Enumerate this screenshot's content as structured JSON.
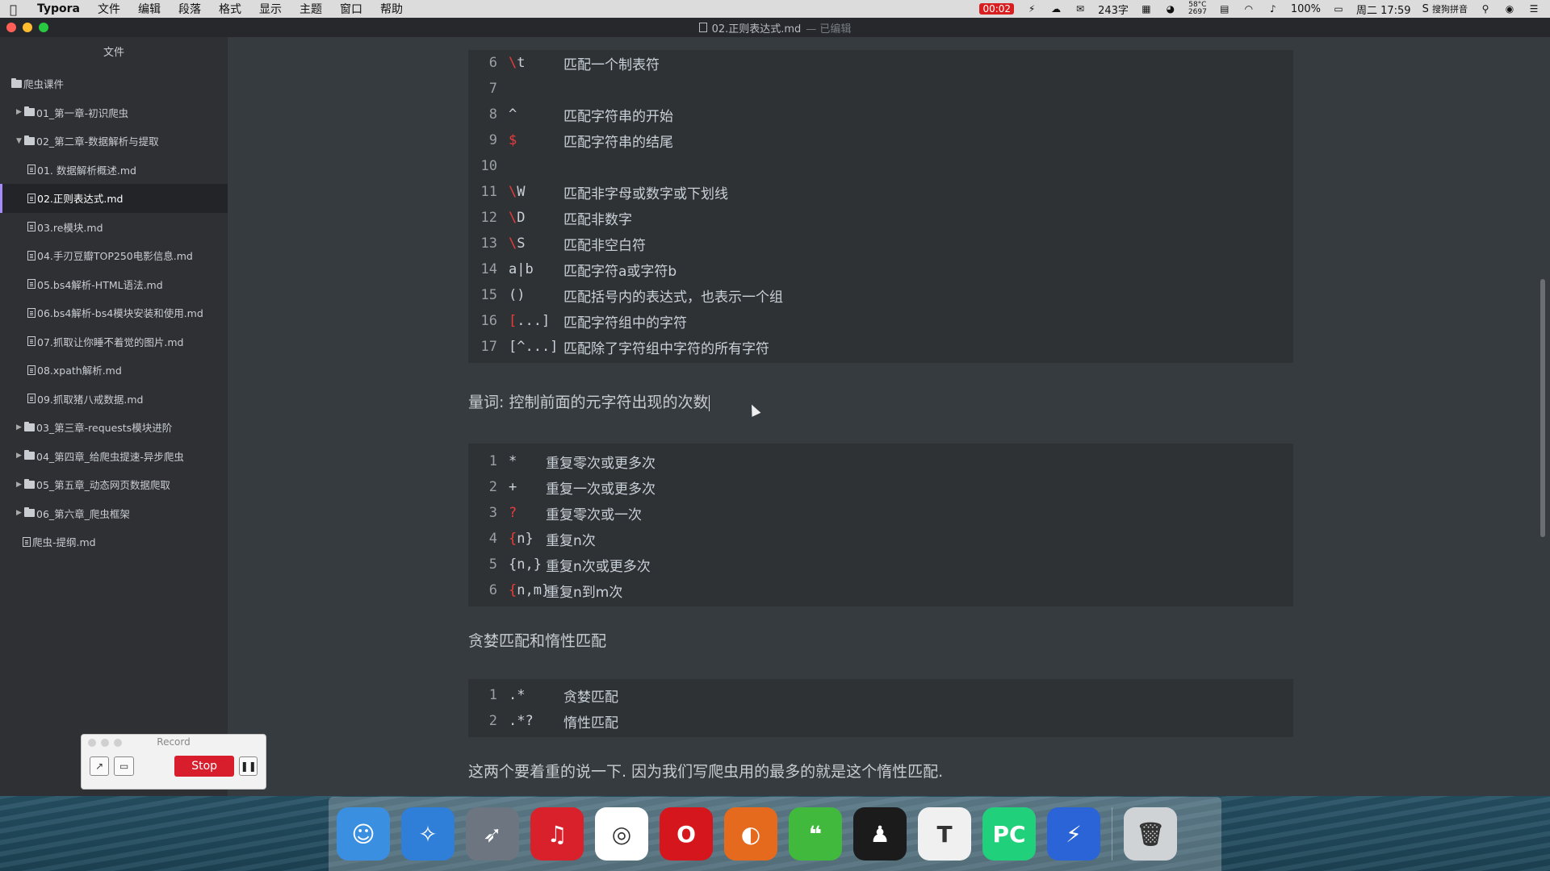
{
  "menubar": {
    "app_name": "Typora",
    "items": [
      "文件",
      "编辑",
      "段落",
      "格式",
      "显示",
      "主题",
      "窗口",
      "帮助"
    ],
    "record_time": "00:02",
    "word_count": "243字",
    "temp_top": "58°C",
    "temp_bottom": "2697",
    "battery": "100%",
    "clock": "周二 17:59",
    "ime": "搜狗拼音"
  },
  "window": {
    "title": "02.正则表达式.md",
    "title_suffix": "— 已编辑"
  },
  "sidebar": {
    "header": "文件",
    "root": "爬虫课件",
    "items": [
      {
        "label": "01_第一章-初识爬虫",
        "type": "folder",
        "expanded": false,
        "depth": 1
      },
      {
        "label": "02_第二章-数据解析与提取",
        "type": "folder",
        "expanded": true,
        "depth": 1
      },
      {
        "label": "01. 数据解析概述.md",
        "type": "file",
        "depth": 2
      },
      {
        "label": "02.正则表达式.md",
        "type": "file",
        "depth": 2,
        "active": true
      },
      {
        "label": "03.re模块.md",
        "type": "file",
        "depth": 2
      },
      {
        "label": "04.手刃豆瓣TOP250电影信息.md",
        "type": "file",
        "depth": 2
      },
      {
        "label": "05.bs4解析-HTML语法.md",
        "type": "file",
        "depth": 2
      },
      {
        "label": "06.bs4解析-bs4模块安装和使用.md",
        "type": "file",
        "depth": 2
      },
      {
        "label": "07.抓取让你睡不着觉的图片.md",
        "type": "file",
        "depth": 2
      },
      {
        "label": "08.xpath解析.md",
        "type": "file",
        "depth": 2
      },
      {
        "label": "09.抓取猪八戒数据.md",
        "type": "file",
        "depth": 2
      },
      {
        "label": "03_第三章-requests模块进阶",
        "type": "folder",
        "expanded": false,
        "depth": 1
      },
      {
        "label": "04_第四章_给爬虫提速-异步爬虫",
        "type": "folder",
        "expanded": false,
        "depth": 1
      },
      {
        "label": "05_第五章_动态网页数据爬取",
        "type": "folder",
        "expanded": false,
        "depth": 1
      },
      {
        "label": "06_第六章_爬虫框架",
        "type": "folder",
        "expanded": false,
        "depth": 1
      },
      {
        "label": "爬虫-提纲.md",
        "type": "file",
        "depth": 1
      }
    ]
  },
  "editor": {
    "block1": [
      {
        "n": "6",
        "sym": "\\",
        "rest": "t",
        "desc": "匹配一个制表符"
      },
      {
        "n": "7",
        "sym": "",
        "rest": "",
        "desc": ""
      },
      {
        "n": "8",
        "sym": "",
        "rest": "^",
        "desc": "匹配字符串的开始"
      },
      {
        "n": "9",
        "sym": "$",
        "rest": "",
        "desc": "匹配字符串的结尾"
      },
      {
        "n": "10",
        "sym": "",
        "rest": "",
        "desc": ""
      },
      {
        "n": "11",
        "sym": "\\",
        "rest": "W",
        "desc": "匹配非字母或数字或下划线"
      },
      {
        "n": "12",
        "sym": "\\",
        "rest": "D",
        "desc": "匹配非数字"
      },
      {
        "n": "13",
        "sym": "\\",
        "rest": "S",
        "desc": "匹配非空白符"
      },
      {
        "n": "14",
        "sym": "",
        "rest": "a|b",
        "desc": "匹配字符a或字符b"
      },
      {
        "n": "15",
        "sym": "",
        "rest": "()",
        "desc": "匹配括号内的表达式，也表示一个组"
      },
      {
        "n": "16",
        "sym": "[",
        "rest": "...]",
        "desc": "匹配字符组中的字符"
      },
      {
        "n": "17",
        "sym": "",
        "rest": "[^...]",
        "desc": "匹配除了字符组中字符的所有字符"
      }
    ],
    "heading_quantifier": "量词: 控制前面的元字符出现的次数",
    "block2": [
      {
        "n": "1",
        "sym": "",
        "rest": "*",
        "desc": "重复零次或更多次"
      },
      {
        "n": "2",
        "sym": "",
        "rest": "+",
        "desc": "重复一次或更多次"
      },
      {
        "n": "3",
        "sym": "?",
        "rest": "",
        "desc": "重复零次或一次"
      },
      {
        "n": "4",
        "sym": "{",
        "rest": "n}",
        "desc": "重复n次"
      },
      {
        "n": "5",
        "sym": "",
        "rest": "{n,}",
        "desc": "重复n次或更多次"
      },
      {
        "n": "6",
        "sym": "{",
        "rest": "n,m}",
        "desc": "重复n到m次"
      }
    ],
    "heading_greedy": "贪婪匹配和惰性匹配",
    "block3": [
      {
        "n": "1",
        "sym": "",
        "rest": ".*",
        "desc": "贪婪匹配"
      },
      {
        "n": "2",
        "sym": "",
        "rest": ".*?",
        "desc": "惰性匹配"
      }
    ],
    "paragraph_note": "这两个要着重的说一下. 因为我们写爬虫用的最多的就是这个惰性匹配."
  },
  "record_widget": {
    "title": "Record",
    "stop_label": "Stop"
  },
  "dock": {
    "icons": [
      {
        "name": "finder",
        "color": "#3b8fe0"
      },
      {
        "name": "safari",
        "color": "#2f7ed8"
      },
      {
        "name": "launchpad",
        "color": "#6c7580"
      },
      {
        "name": "netease-music",
        "color": "#d8212b"
      },
      {
        "name": "chrome",
        "color": "#ffffff"
      },
      {
        "name": "opera",
        "color": "#d6161d"
      },
      {
        "name": "firefox",
        "color": "#e66a1d"
      },
      {
        "name": "wechat",
        "color": "#40b93c"
      },
      {
        "name": "qq",
        "color": "#1b1b1b"
      },
      {
        "name": "typora",
        "color": "#f0f0f0"
      },
      {
        "name": "pycharm",
        "color": "#21d07a"
      },
      {
        "name": "thunder",
        "color": "#2a64d6"
      },
      {
        "name": "trash",
        "color": "#cfd3d6"
      }
    ]
  }
}
